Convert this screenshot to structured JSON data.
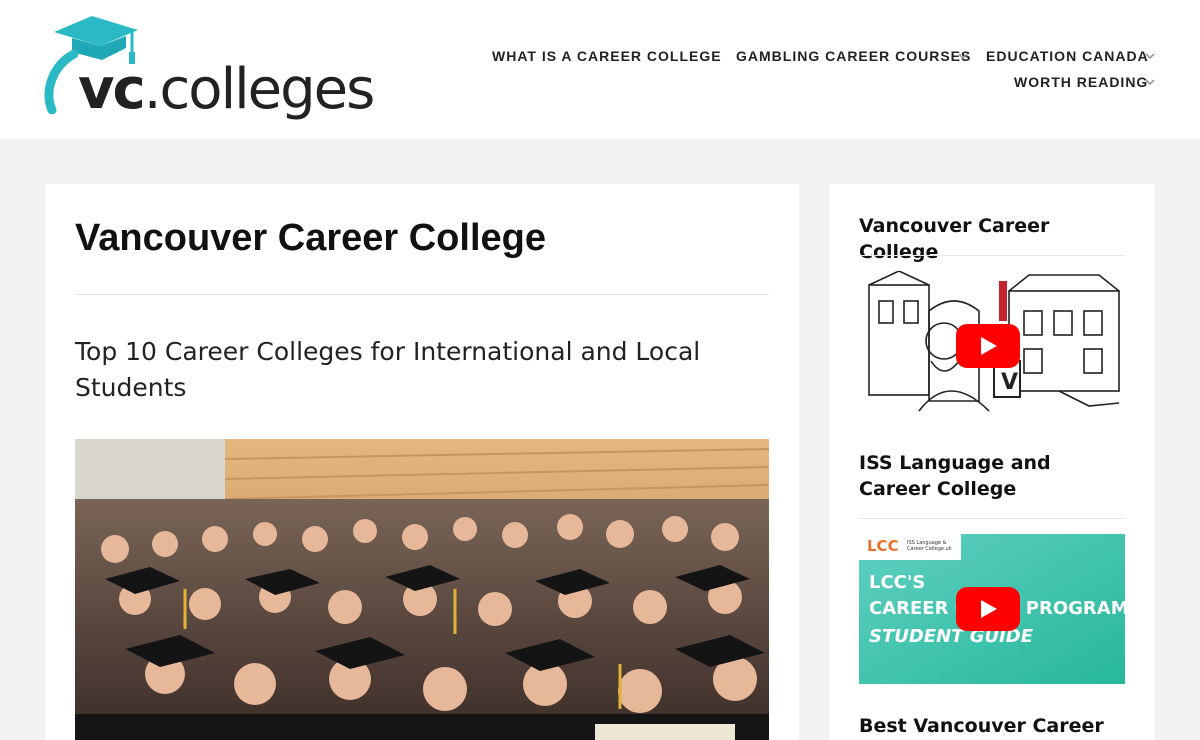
{
  "header": {
    "logo": {
      "text_bold": "vc",
      "text_dot": ".",
      "text_rest": "colleges",
      "primary_color": "#2bb9c6"
    },
    "nav": [
      {
        "label": "WHAT IS A CAREER COLLEGE",
        "has_dropdown": false
      },
      {
        "label": "GAMBLING CAREER COURSES",
        "has_dropdown": true
      },
      {
        "label": "EDUCATION CANADA",
        "has_dropdown": true
      },
      {
        "label": "WORTH READING",
        "has_dropdown": true
      }
    ]
  },
  "main": {
    "title": "Vancouver Career College",
    "subtitle": "Top 10 Career Colleges for International and Local Students",
    "hero_image": "graduation-ceremony-photo"
  },
  "sidebar": {
    "widgets": [
      {
        "title": "Vancouver Career College",
        "video": "vancouver-career-college-video"
      },
      {
        "title": "ISS Language and Career College",
        "video": "lcc-career-coop-video",
        "video_text": {
          "logo": "LCC",
          "logo_small": "ISS Language & Career College.uk",
          "line1": "LCC'S",
          "line2": "CAREER CO-OP PROGRAM",
          "line3": "STUDENT GUIDE"
        }
      },
      {
        "title": "Best Vancouver Career"
      }
    ],
    "youtube_color": "#ff0000"
  }
}
